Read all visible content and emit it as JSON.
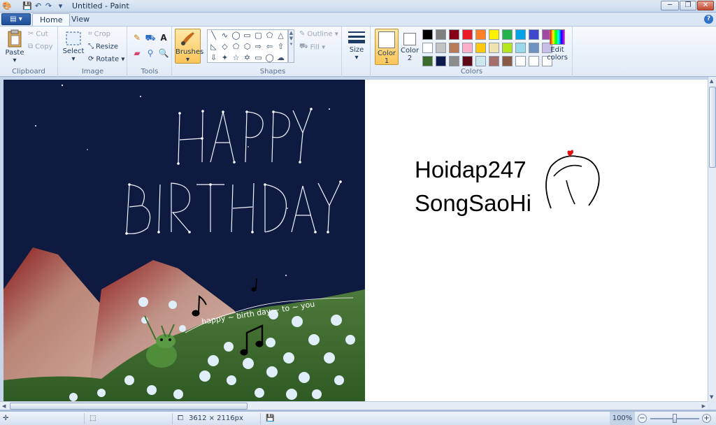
{
  "window": {
    "title": "Untitled - Paint",
    "minimize_icon": "minimize-icon",
    "maximize_icon": "restore-icon",
    "close_icon": "close-icon"
  },
  "tabs": {
    "home": "Home",
    "view": "View"
  },
  "clipboard": {
    "paste": "Paste",
    "cut": "Cut",
    "copy": "Copy",
    "label": "Clipboard"
  },
  "image": {
    "select": "Select",
    "crop": "Crop",
    "resize": "Resize",
    "rotate": "Rotate",
    "label": "Image"
  },
  "tools": {
    "label": "Tools",
    "brushes": "Brushes"
  },
  "shapes": {
    "outline": "Outline",
    "fill": "Fill",
    "label": "Shapes"
  },
  "size": {
    "label": "Size"
  },
  "colors": {
    "label": "Colors",
    "color1": "Color",
    "color1_num": "1",
    "color2": "Color",
    "color2_num": "2",
    "edit": "Edit colors",
    "palette": [
      "#000000",
      "#7f7f7f",
      "#880015",
      "#ed1c24",
      "#ff7f27",
      "#fff200",
      "#22b14c",
      "#00a2e8",
      "#3f48cc",
      "#a349a4",
      "#ffffff",
      "#c3c3c3",
      "#b97a57",
      "#ffaec9",
      "#ffc90e",
      "#efe4b0",
      "#b5e61d",
      "#99d9ea",
      "#7092be",
      "#c8bfe7",
      "#3a6b2a",
      "#0c1a4b",
      "#8c8c8c",
      "#5e0a14",
      "#cde7f0",
      "#a66d6d",
      "#8a5a44",
      "#ffffff",
      "#ffffff",
      "#ffffff"
    ]
  },
  "canvas": {
    "card_text_1": "HAPPY",
    "card_text_2": "BIRTHDAY",
    "card_text_3": "happy ~ birth day ~ to ~ you",
    "signature_line1": "Hoidap247",
    "signature_line2": "SongSaoHi"
  },
  "status": {
    "dimensions": "3612 × 2116px",
    "zoom": "100%"
  }
}
